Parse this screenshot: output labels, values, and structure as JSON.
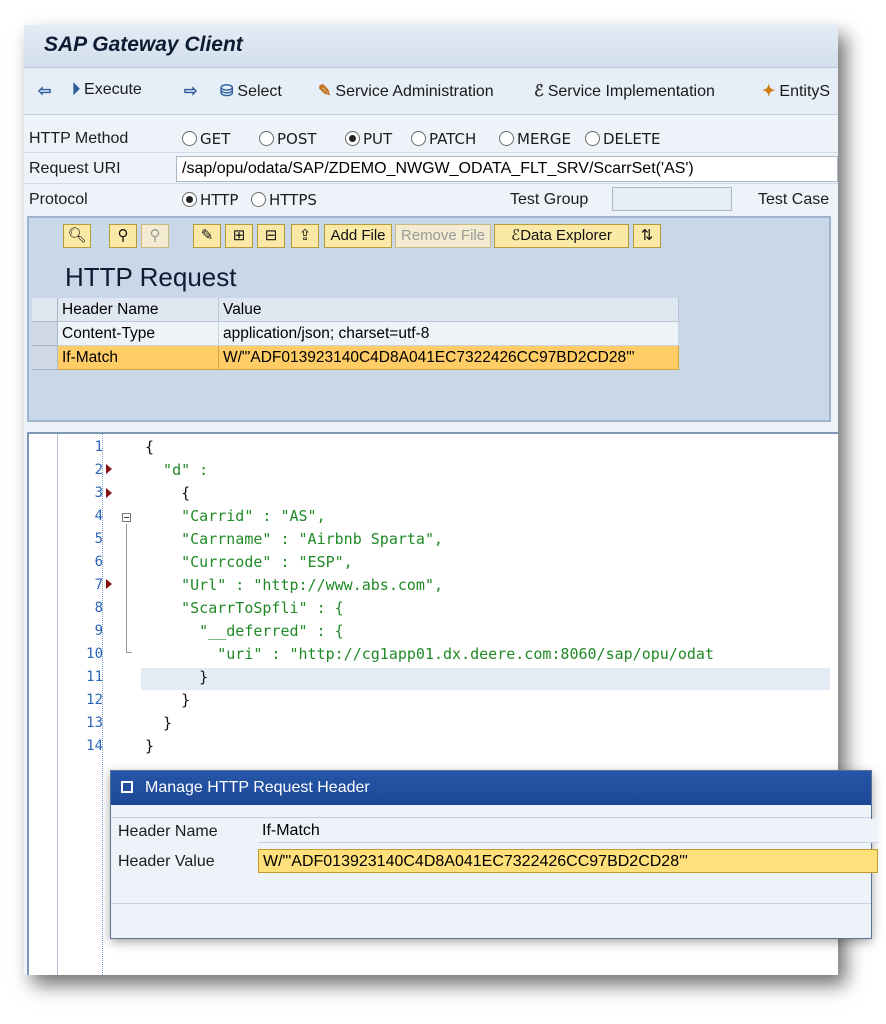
{
  "window": {
    "title": "SAP Gateway Client"
  },
  "app_toolbar": {
    "execute": "Execute",
    "select": "Select",
    "service_admin": "Service Administration",
    "service_impl": "Service Implementation",
    "entity_sets": "EntityS"
  },
  "request": {
    "method_label": "HTTP Method",
    "methods": [
      "GET",
      "POST",
      "PUT",
      "PATCH",
      "MERGE",
      "DELETE"
    ],
    "selected_method": "PUT",
    "uri_label": "Request URI",
    "uri_value": "/sap/opu/odata/SAP/ZDEMO_NWGW_ODATA_FLT_SRV/ScarrSet('AS')",
    "protocol_label": "Protocol",
    "protocols": [
      "HTTP",
      "HTTPS"
    ],
    "selected_protocol": "HTTP",
    "test_group_label": "Test Group",
    "test_group_value": "",
    "test_case_label": "Test Case"
  },
  "panel_toolbar": {
    "add_file": "Add File",
    "remove_file": "Remove File",
    "data_explorer": "Data Explorer"
  },
  "http_request": {
    "title": "HTTP Request",
    "col_name": "Header Name",
    "col_value": "Value",
    "rows": [
      {
        "name": "Content-Type",
        "value": "application/json; charset=utf-8"
      },
      {
        "name": "If-Match",
        "value": "W/\"'ADF013923140C4D8A041EC7322426CC97BD2CD28'\""
      }
    ]
  },
  "editor": {
    "line_numbers": [
      "1",
      "2",
      "3",
      "4",
      "5",
      "6",
      "7",
      "8",
      "9",
      "10",
      "11",
      "12",
      "13",
      "14"
    ],
    "lines": [
      "{",
      "  \"d\" :",
      "    {",
      "    \"Carrid\" : \"AS\",",
      "    \"Carrname\" : \"Airbnb Sparta\",",
      "    \"Currcode\" : \"ESP\",",
      "    \"Url\" : \"http://www.abs.com\",",
      "    \"ScarrToSpfli\" : {",
      "      \"__deferred\" : {",
      "        \"uri\" : \"http://cg1app01.dx.deere.com:8060/sap/opu/odat",
      "      }",
      "    }",
      "  }",
      "}"
    ]
  },
  "dialog": {
    "title": "Manage HTTP Request Header",
    "name_label": "Header Name",
    "name_value": "If-Match",
    "value_label": "Header Value",
    "value_value": "W/\"'ADF013923140C4D8A041EC7322426CC97BD2CD28'\""
  }
}
